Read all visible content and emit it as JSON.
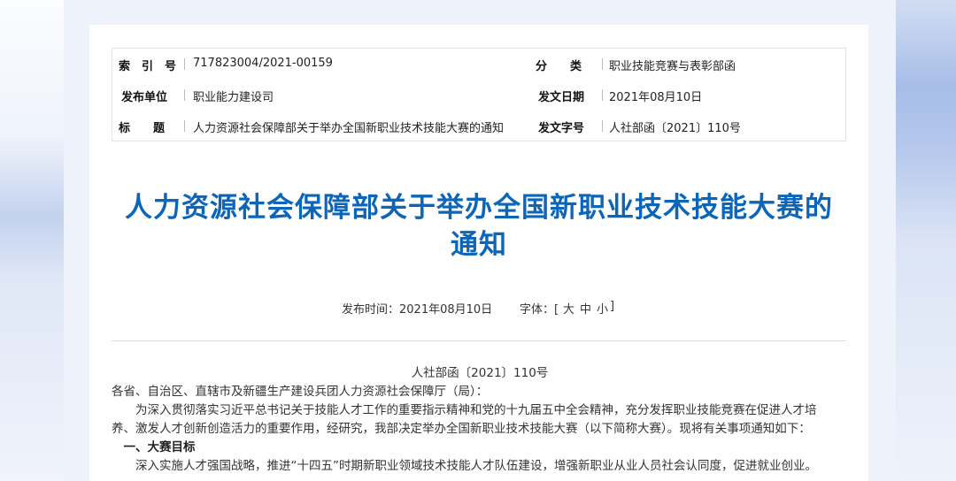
{
  "meta": {
    "index_label": "索　引　号",
    "index_value": "717823004/2021-00159",
    "category_label": "分　　类",
    "category_value": "职业技能竞赛与表彰部函",
    "issuer_label": "发布单位",
    "issuer_value": "职业能力建设司",
    "date_label": "发文日期",
    "date_value": "2021年08月10日",
    "title_label": "标　　题",
    "title_value": "人力资源社会保障部关于举办全国新职业技术技能大赛的通知",
    "docno_label": "发文字号",
    "docno_value": "人社部函〔2021〕110号"
  },
  "doc_title_line1": "人力资源社会保障部关于举办全国新职业技术技能大赛的",
  "doc_title_line2": "通知",
  "pubinfo": {
    "publish_time": "发布时间：2021年08月10日",
    "font_label": "字体：[",
    "font_large": "大",
    "font_medium": "中",
    "font_small": "小",
    "font_close": "]"
  },
  "body": {
    "doc_number": "人社部函〔2021〕110号",
    "salutation": "各省、自治区、直辖市及新疆生产建设兵团人力资源社会保障厅（局）：",
    "para1_line1": "为深入贯彻落实习近平总书记关于技能人才工作的重要指示精神和党的十九届五中全会精神，充分发挥职业技能竞赛在促进人才培",
    "para1_line2": "养、激发人才创新创造活力的重要作用，经研究，我部决定举办全国新职业技术技能大赛（以下简称大赛）。现将有关事项通知如下：",
    "heading1": "一、大赛目标",
    "para2_line1": "深入实施人才强国战略，推进“十四五”时期新职业领域技术技能人才队伍建设，增强新职业从业人员社会认同度，促进就业创业。"
  }
}
